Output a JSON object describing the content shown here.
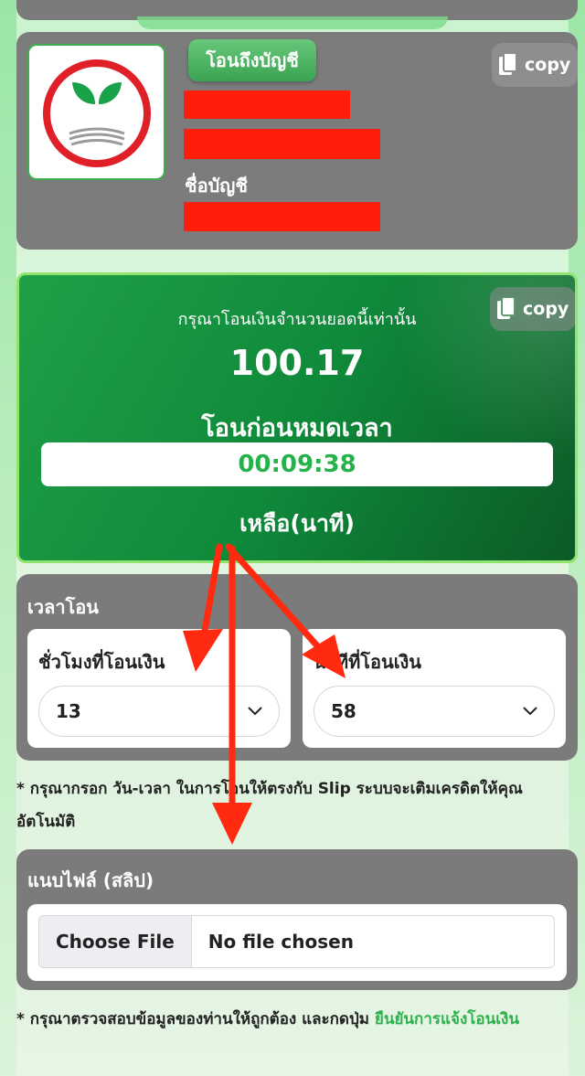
{
  "bank": {
    "transfer_tag": "โอนถึงบัญชี",
    "copy_label": "copy",
    "account_name_label": "ชื่อบัญชี",
    "logo_icon": "kasikorn-bank-logo"
  },
  "amount": {
    "note": "กรุณาโอนเงินจำนวนยอดนี้เท่านั้น",
    "value": "100.17",
    "copy_label": "copy",
    "before_label": "โอนก่อนหมดเวลา",
    "timer": "00:09:38",
    "remain_label": "เหลือ(นาที)"
  },
  "transfer_time": {
    "title": "เวลาโอน",
    "hour_label": "ชั่วโมงที่โอนเงิน",
    "hour_value": "13",
    "minute_label": "นาทีที่โอนเงิน",
    "minute_value": "58"
  },
  "notes": {
    "slip_note": "* กรุณากรอก วัน-เวลา ในการโอนให้ตรงกับ Slip ระบบจะเติมเครดิตให้คุณอัตโนมัติ",
    "confirm_note_prefix": "* กรุณาตรวจสอบข้อมูลของท่านให้ถูกต้อง และกดปุ่ม ",
    "confirm_note_link": "ยืนยันการแจ้งโอนเงิน"
  },
  "attach": {
    "title": "แนบไฟล์ (สลิป)",
    "choose_button": "Choose File",
    "status": "No file chosen"
  },
  "colors": {
    "card_gray": "#7b7b7b",
    "accent_green": "#2eb14d",
    "redaction": "#ff1d0b",
    "annotation_arrow": "#ff2a0f"
  }
}
